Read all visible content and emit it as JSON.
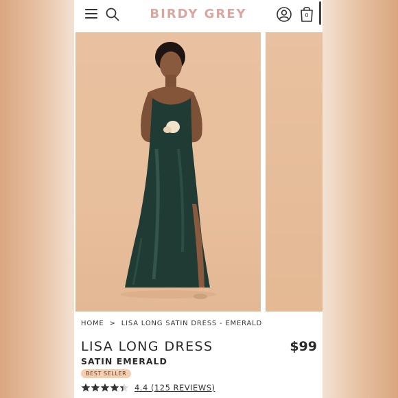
{
  "brand": {
    "logo_text": "BIRDY GREY",
    "logo_color": "#d9a6a0"
  },
  "header": {
    "menu_icon": "hamburger-icon",
    "search_icon": "search-icon",
    "account_icon": "account-icon",
    "bag_icon": "shopping-bag-icon",
    "bag_count": "0"
  },
  "gallery": {
    "main_image": "woman-in-emerald-satin-dress-photo",
    "next_image": "next-product-photo-peek"
  },
  "breadcrumb": {
    "home": "HOME",
    "separator": ">",
    "current": "LISA LONG SATIN DRESS - EMERALD"
  },
  "product": {
    "title": "LISA LONG DRESS",
    "subtitle": "SATIN EMERALD",
    "price": "$99",
    "badge": "BEST SELLER",
    "rating_value": 4.4,
    "rating_max": 5,
    "reviews_text": "4.4 (125 REVIEWS)"
  },
  "colors": {
    "badge_bg": "#f4cfb0",
    "dress": "#1f3b33",
    "backdrop": "#e8bf9c"
  }
}
